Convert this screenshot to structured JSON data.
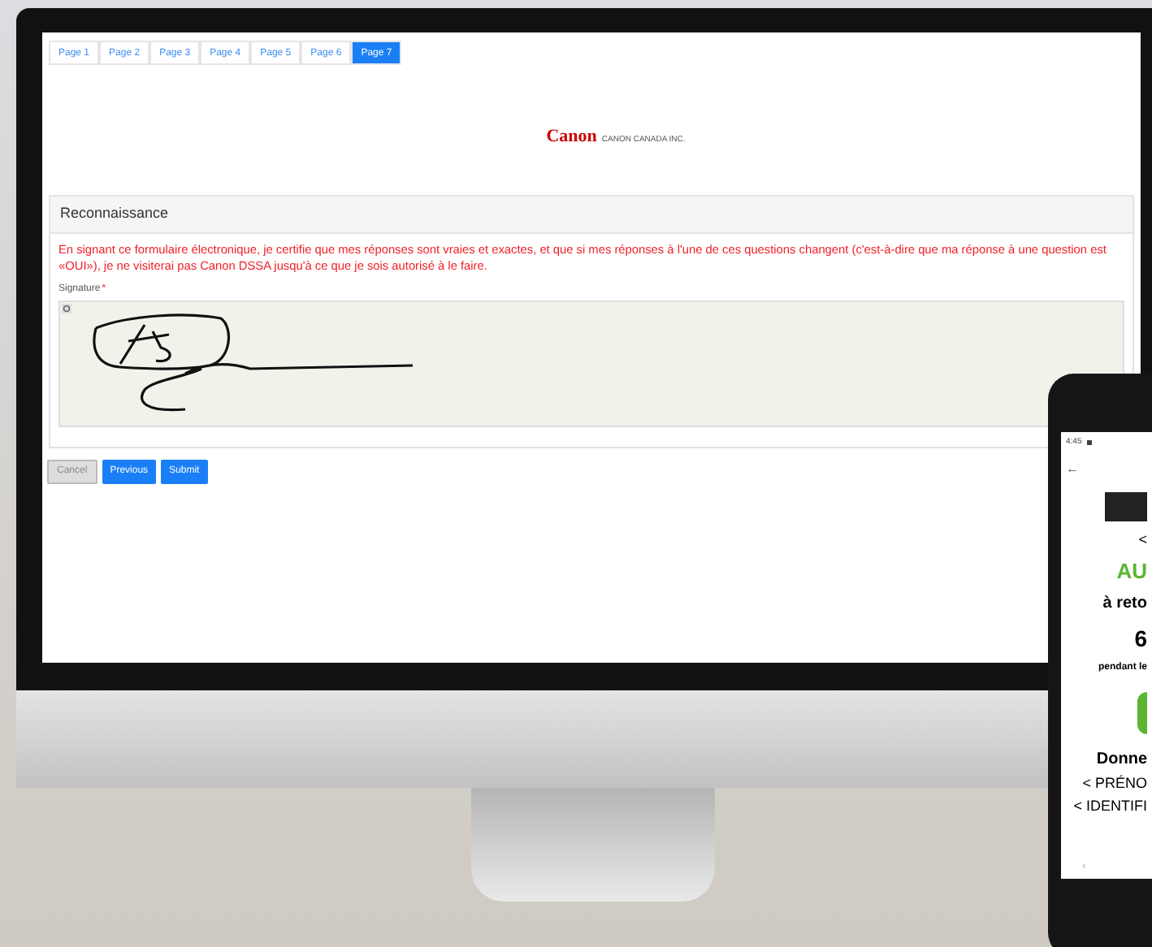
{
  "tabs": [
    {
      "label": "Page 1",
      "selected": false
    },
    {
      "label": "Page 2",
      "selected": false
    },
    {
      "label": "Page 3",
      "selected": false
    },
    {
      "label": "Page 4",
      "selected": false
    },
    {
      "label": "Page 5",
      "selected": false
    },
    {
      "label": "Page 6",
      "selected": false
    },
    {
      "label": "Page 7",
      "selected": true
    }
  ],
  "logo": {
    "brand": "Canon",
    "tagline": "CANON CANADA INC."
  },
  "panel": {
    "title": "Reconnaissance",
    "statement": "En signant ce formulaire électronique, je certifie que mes réponses sont vraies et exactes, et que si mes réponses à l'une de ces questions changent (c'est-à-dire que ma réponse à une question est «OUI»), je ne visiterai pas Canon DSSA jusqu'à ce que je sois autorisé à le faire.",
    "signature_label": "Signature",
    "required_mark": "*"
  },
  "buttons": [
    {
      "label": "Cancel",
      "disabled": true
    },
    {
      "label": "Previous",
      "disabled": false
    },
    {
      "label": "Submit",
      "disabled": false
    }
  ],
  "phone": {
    "time": "4:45",
    "back": "←",
    "lines": [
      {
        "text": "<",
        "kind": "plain"
      },
      {
        "text": "AU",
        "kind": "green"
      },
      {
        "text": "à reto",
        "kind": "bold"
      },
      {
        "text": "6",
        "kind": "big"
      },
      {
        "text": "pendant le",
        "kind": "small"
      },
      {
        "text": "Donne",
        "kind": "bold"
      },
      {
        "text": "< PRÉNO",
        "kind": "plain"
      },
      {
        "text": "< IDENTIFI",
        "kind": "plain"
      }
    ],
    "nav": "‹"
  }
}
